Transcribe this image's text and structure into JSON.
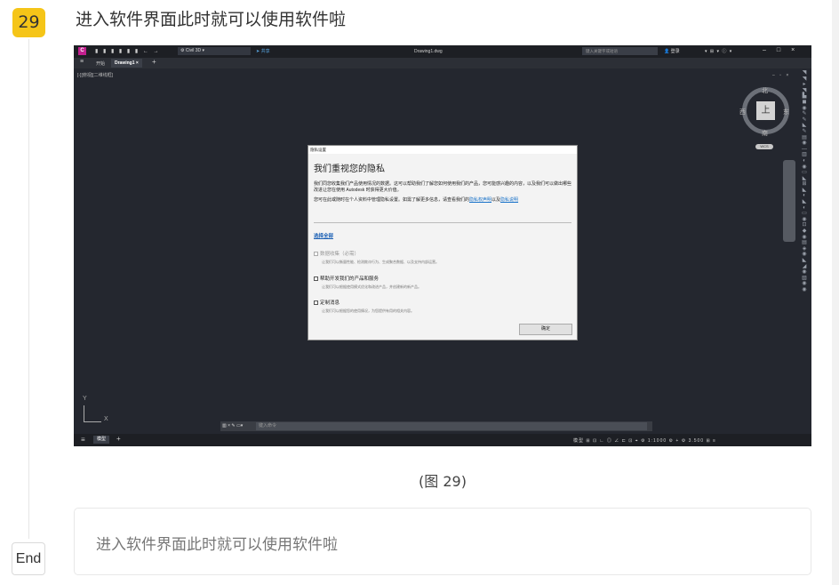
{
  "step": {
    "number": "29",
    "title": "进入软件界面此时就可以使用软件啦"
  },
  "caption": "(图 29)",
  "note": "进入软件界面此时就可以使用软件啦",
  "end_label": "End",
  "app": {
    "logo": "C",
    "workspace": "Civil 3D",
    "share": "共享",
    "document_title": "Drawing1.dwg",
    "search_placeholder": "键入关键字或短语",
    "login": "登录",
    "tabs": {
      "start": "开始",
      "drawing": "Drawing1"
    },
    "viewport_label": "[-][俯视][二维线框]",
    "viewcube": {
      "face": "上",
      "north": "北",
      "south": "南",
      "west": "西",
      "east": "东",
      "wcs": "WCS"
    },
    "ucs": {
      "x": "X",
      "y": "Y"
    },
    "command_placeholder": "键入命令",
    "status": {
      "model": "模型",
      "right_text": "模型 ⊞ ⊡ ∟ ◎ ∠ ⊏ ⊡ ⌖ ⚙ 1:1000 ⚙ + ⚙ 3.500 ⊞ ≡"
    },
    "colors": {
      "accent": "#f5c518",
      "app_bg": "#24272f",
      "link": "#1a73c9"
    }
  },
  "dialog": {
    "window_title": "隐私设置",
    "heading": "我们重视您的隐私",
    "p1": "我们同您收集我们产品使用情况的数据。这可以帮助我们了解您如何使用我们的产品，您可能感兴趣的内容，以及我们可以做出哪些改进让您在使用 Autodesk 时获得更大价值。",
    "p2_a": "您可在此或随时在个人资料中管理隐私设置。如需了解更多信息，请查看我们的",
    "p2_link": "隐私权声明",
    "p2_b": "以及",
    "p2_link2": "隐私说明",
    "select_all": "选择全部",
    "options": [
      {
        "label": "数据收集（必需）",
        "desc": "让我们可以衡量性能、检测欺诈行为、生成聚合数据、以及支持内部运营。",
        "disabled": true
      },
      {
        "label": "帮助开发我们的产品和服务",
        "desc": "让我们可以根据使用模式优化和改进产品，并创建新的新产品。",
        "disabled": false
      },
      {
        "label": "定制消息",
        "desc": "让我们可以根据您的使用情况，为您提供有用的相关内容。",
        "disabled": false
      }
    ],
    "ok": "确定"
  }
}
